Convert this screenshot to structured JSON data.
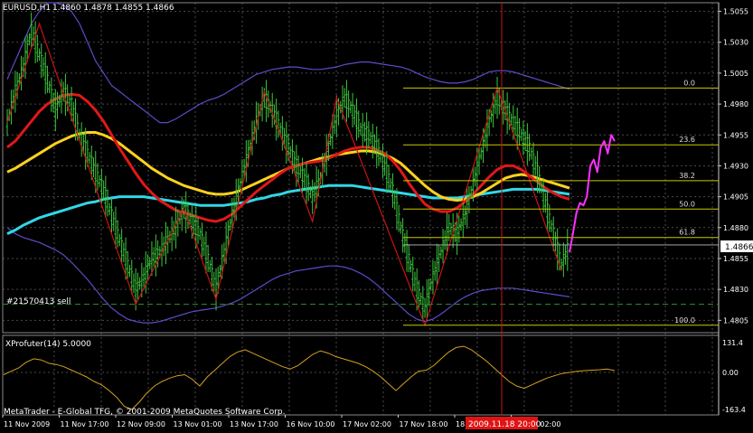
{
  "window": {
    "symbol_title": "EURUSD,H1",
    "ohlc": "1.4860 1.4878 1.4855 1.4866",
    "order_label": "#21570413 sell",
    "watermark": "MetaTrader - E-Global TFG, © 2001-2009 MetaQuotes Software Corp.",
    "current_price": "1.4866",
    "time_cursor_label": "2009.11.18 20:00"
  },
  "colors": {
    "background": "#000000",
    "grid": "#4a4a4a",
    "bull_candle": "#3cc83c",
    "bear_candle": "#3cc83c",
    "bollinger": "#5d4bc8",
    "ma_fast": "#e01818",
    "ma_mid": "#ffd21e",
    "ma_slow": "#30d8e8",
    "zigzag": "#c81414",
    "fibo": "#c8c800",
    "projection": "#ff30ff",
    "oscillator": "#d4a020",
    "vline": "#c81414",
    "axis_text": "#ffffff"
  },
  "chart_data": {
    "type": "line",
    "title": "EURUSD,H1",
    "price_axis": {
      "ticks": [
        "1.5055",
        "1.5030",
        "1.5005",
        "1.4980",
        "1.4955",
        "1.4930",
        "1.4905",
        "1.4880",
        "1.4855",
        "1.4830",
        "1.4805"
      ],
      "tick_values": [
        1.5055,
        1.503,
        1.5005,
        1.498,
        1.4955,
        1.493,
        1.4905,
        1.488,
        1.4855,
        1.483,
        1.4805
      ],
      "ylim": [
        1.4795,
        1.5062
      ]
    },
    "time_axis": {
      "ticks": [
        "11 Nov 2009",
        "11 Nov 17:00",
        "12 Nov 09:00",
        "13 Nov 01:00",
        "13 Nov 17:00",
        "16 Nov 10:00",
        "17 Nov 02:00",
        "17 Nov 18:00",
        "18 Nov 10:00",
        "19 Nov 02:00"
      ]
    },
    "fibonacci": [
      {
        "level": "0.0",
        "price": 1.4993
      },
      {
        "level": "23.6",
        "price": 1.4947
      },
      {
        "level": "38.2",
        "price": 1.4918
      },
      {
        "level": "50.0",
        "price": 1.4895
      },
      {
        "level": "61.8",
        "price": 1.4872
      },
      {
        "level": "100.0",
        "price": 1.4801
      }
    ],
    "order_price": 1.4818,
    "current_price": 1.4866,
    "series": [
      {
        "key": "close",
        "values": [
          1.4965,
          1.499,
          1.501,
          1.504,
          1.502,
          1.5,
          1.4975,
          1.499,
          1.498,
          1.4955,
          1.494,
          1.4925,
          1.491,
          1.489,
          1.487,
          1.485,
          1.483,
          1.484,
          1.4855,
          1.486,
          1.487,
          1.488,
          1.4895,
          1.4885,
          1.4875,
          1.4855,
          1.483,
          1.486,
          1.489,
          1.4915,
          1.494,
          1.4965,
          1.4985,
          1.4975,
          1.496,
          1.4945,
          1.493,
          1.492,
          1.4905,
          1.492,
          1.4945,
          1.497,
          1.4985,
          1.4975,
          1.496,
          1.4955,
          1.4945,
          1.493,
          1.491,
          1.488,
          1.4855,
          1.483,
          1.4815,
          1.484,
          1.486,
          1.488,
          1.4875,
          1.489,
          1.4915,
          1.494,
          1.4965,
          1.4985,
          1.4975,
          1.4965,
          1.4955,
          1.4945,
          1.4925,
          1.49,
          1.4875,
          1.485,
          1.4866
        ]
      },
      {
        "key": "ma_fast",
        "values": [
          1.4945,
          1.495,
          1.4958,
          1.4966,
          1.4974,
          1.498,
          1.4984,
          1.4987,
          1.4988,
          1.4987,
          1.4982,
          1.4975,
          1.4966,
          1.4955,
          1.4944,
          1.4934,
          1.4924,
          1.4915,
          1.4908,
          1.4902,
          1.4898,
          1.4894,
          1.4892,
          1.489,
          1.4888,
          1.4886,
          1.4885,
          1.4887,
          1.4891,
          1.4897,
          1.4903,
          1.4909,
          1.4914,
          1.4919,
          1.4924,
          1.4928,
          1.493,
          1.4932,
          1.4933,
          1.4934,
          1.4936,
          1.4939,
          1.4942,
          1.4944,
          1.4945,
          1.4945,
          1.4943,
          1.494,
          1.4934,
          1.4926,
          1.4916,
          1.4907,
          1.4899,
          1.4895,
          1.4893,
          1.4893,
          1.4896,
          1.4901,
          1.4907,
          1.4914,
          1.4921,
          1.4927,
          1.493,
          1.493,
          1.4927,
          1.4922,
          1.4917,
          1.4912,
          1.4908,
          1.4905,
          1.4903
        ]
      },
      {
        "key": "ma_mid",
        "values": [
          1.4925,
          1.4928,
          1.4932,
          1.4936,
          1.494,
          1.4944,
          1.4948,
          1.4951,
          1.4954,
          1.4956,
          1.4957,
          1.4957,
          1.4955,
          1.4952,
          1.4948,
          1.4943,
          1.4938,
          1.4933,
          1.4928,
          1.4924,
          1.492,
          1.4917,
          1.4914,
          1.4912,
          1.491,
          1.4908,
          1.4907,
          1.4907,
          1.4908,
          1.491,
          1.4913,
          1.4916,
          1.4919,
          1.4922,
          1.4925,
          1.4928,
          1.493,
          1.4932,
          1.4934,
          1.4936,
          1.4937,
          1.4939,
          1.494,
          1.4941,
          1.4942,
          1.4942,
          1.4941,
          1.4939,
          1.4936,
          1.4932,
          1.4926,
          1.492,
          1.4914,
          1.4909,
          1.4905,
          1.4903,
          1.4902,
          1.4903,
          1.4905,
          1.4908,
          1.4912,
          1.4916,
          1.492,
          1.4922,
          1.4923,
          1.4922,
          1.492,
          1.4918,
          1.4916,
          1.4914,
          1.4912
        ]
      },
      {
        "key": "ma_slow",
        "values": [
          1.4875,
          1.4878,
          1.4882,
          1.4885,
          1.4888,
          1.489,
          1.4892,
          1.4894,
          1.4896,
          1.4898,
          1.49,
          1.4901,
          1.4903,
          1.4904,
          1.4905,
          1.4905,
          1.4905,
          1.4905,
          1.4904,
          1.4903,
          1.4902,
          1.4901,
          1.49,
          1.4899,
          1.4898,
          1.4898,
          1.4898,
          1.4898,
          1.4899,
          1.49,
          1.4901,
          1.4903,
          1.4904,
          1.4906,
          1.4907,
          1.4909,
          1.491,
          1.4911,
          1.4912,
          1.4913,
          1.4914,
          1.4914,
          1.4914,
          1.4914,
          1.4913,
          1.4912,
          1.4911,
          1.491,
          1.4909,
          1.4908,
          1.4907,
          1.4906,
          1.4905,
          1.4904,
          1.4904,
          1.4904,
          1.4904,
          1.4905,
          1.4906,
          1.4907,
          1.4908,
          1.4909,
          1.491,
          1.4911,
          1.4911,
          1.4911,
          1.4911,
          1.491,
          1.4909,
          1.4908,
          1.4907
        ]
      },
      {
        "key": "bb_upper",
        "values": [
          1.5,
          1.5015,
          1.503,
          1.5045,
          1.5055,
          1.5062,
          1.5062,
          1.506,
          1.5055,
          1.5045,
          1.503,
          1.5015,
          1.5005,
          1.4995,
          1.499,
          1.4985,
          1.498,
          1.4975,
          1.497,
          1.4965,
          1.4965,
          1.4968,
          1.4972,
          1.4976,
          1.498,
          1.4983,
          1.4985,
          1.4988,
          1.4992,
          1.4996,
          1.5,
          1.5004,
          1.5006,
          1.5008,
          1.5009,
          1.501,
          1.501,
          1.5009,
          1.5008,
          1.5008,
          1.5009,
          1.501,
          1.5012,
          1.5013,
          1.5014,
          1.5014,
          1.5013,
          1.5012,
          1.5011,
          1.501,
          1.5008,
          1.5005,
          1.5002,
          1.5,
          1.4998,
          1.4997,
          1.4997,
          1.4998,
          1.5,
          1.5003,
          1.5006,
          1.5007,
          1.5007,
          1.5006,
          1.5004,
          1.5002,
          1.5,
          1.4998,
          1.4996,
          1.4994,
          1.4992
        ]
      },
      {
        "key": "bb_lower",
        "values": [
          1.488,
          1.4875,
          1.4872,
          1.487,
          1.4868,
          1.4865,
          1.4862,
          1.4858,
          1.4852,
          1.4845,
          1.4838,
          1.483,
          1.4822,
          1.4815,
          1.481,
          1.4806,
          1.4804,
          1.4803,
          1.4803,
          1.4804,
          1.4806,
          1.4808,
          1.481,
          1.4812,
          1.4813,
          1.4814,
          1.4815,
          1.4817,
          1.4819,
          1.4822,
          1.4826,
          1.483,
          1.4834,
          1.4838,
          1.4841,
          1.4843,
          1.4845,
          1.4846,
          1.4847,
          1.4848,
          1.4849,
          1.4849,
          1.4848,
          1.4846,
          1.4843,
          1.4839,
          1.4834,
          1.4828,
          1.4822,
          1.4816,
          1.481,
          1.4806,
          1.4804,
          1.4806,
          1.481,
          1.4815,
          1.482,
          1.4824,
          1.4827,
          1.4829,
          1.483,
          1.4831,
          1.4831,
          1.4831,
          1.483,
          1.4829,
          1.4828,
          1.4827,
          1.4826,
          1.4825,
          1.4824
        ]
      }
    ],
    "zigzag": [
      [
        0,
        1.4965
      ],
      [
        4,
        1.5045
      ],
      [
        16,
        1.4818
      ],
      [
        22,
        1.4895
      ],
      [
        26,
        1.4822
      ],
      [
        32,
        1.499
      ],
      [
        38,
        1.4885
      ],
      [
        41,
        1.4985
      ],
      [
        52,
        1.4801
      ],
      [
        61,
        1.4993
      ],
      [
        69,
        1.4845
      ]
    ],
    "projection": [
      1.486,
      1.4875,
      1.4892,
      1.49,
      1.4898,
      1.4905,
      1.493,
      1.4935,
      1.4925,
      1.4945,
      1.495,
      1.494,
      1.4955,
      1.495
    ],
    "oscillator": {
      "label": "XProfuter(14) 5.0000",
      "ticks": [
        "131.4",
        "0.00",
        "-163.4"
      ],
      "tick_values": [
        131.4,
        0,
        -163.4
      ],
      "values": [
        -10,
        5,
        20,
        45,
        60,
        55,
        40,
        35,
        25,
        10,
        -5,
        -20,
        -40,
        -55,
        -80,
        -110,
        -150,
        -163,
        -130,
        -90,
        -60,
        -40,
        -25,
        -15,
        -10,
        -30,
        -60,
        -20,
        10,
        40,
        70,
        90,
        100,
        85,
        70,
        55,
        40,
        25,
        15,
        30,
        55,
        80,
        95,
        85,
        70,
        60,
        50,
        40,
        25,
        5,
        -20,
        -50,
        -80,
        -50,
        -20,
        5,
        10,
        30,
        60,
        90,
        110,
        115,
        100,
        75,
        50,
        20,
        -10,
        -40,
        -60,
        -70,
        -55,
        -40,
        -25,
        -15,
        -5,
        0,
        5,
        8,
        10,
        12,
        15,
        8
      ]
    }
  }
}
